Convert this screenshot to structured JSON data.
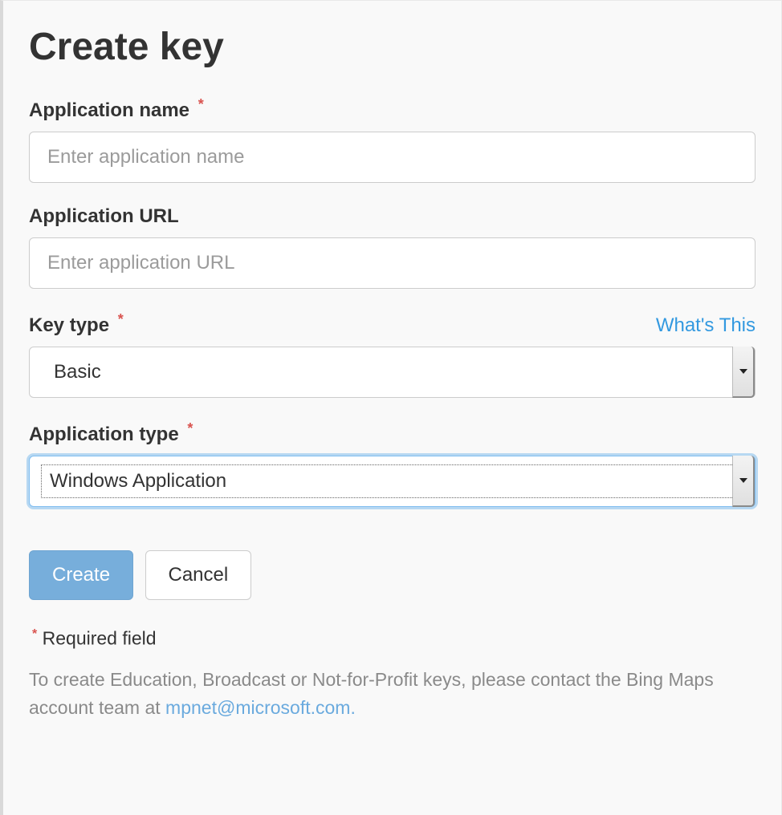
{
  "title": "Create key",
  "required_marker": "*",
  "fields": {
    "appName": {
      "label": "Application name",
      "required": true,
      "placeholder": "Enter application name",
      "value": ""
    },
    "appUrl": {
      "label": "Application URL",
      "required": false,
      "placeholder": "Enter application URL",
      "value": ""
    },
    "keyType": {
      "label": "Key type",
      "required": true,
      "help": "What's This",
      "selected": "Basic"
    },
    "appType": {
      "label": "Application type",
      "required": true,
      "selected": "Windows Application"
    }
  },
  "buttons": {
    "create": "Create",
    "cancel": "Cancel"
  },
  "notes": {
    "required": "Required field",
    "foot_prefix": "To create Education, Broadcast or Not-for-Profit keys, please contact the Bing Maps account team at ",
    "foot_link": "mpnet@microsoft.com."
  }
}
